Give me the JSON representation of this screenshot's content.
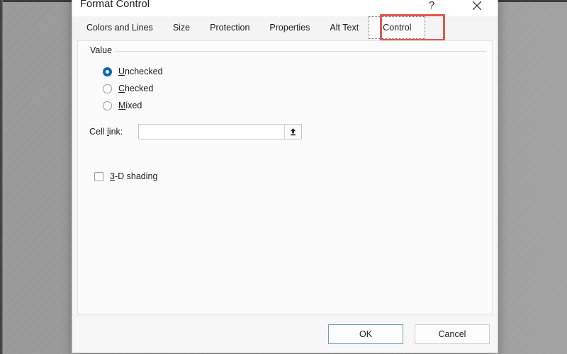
{
  "window": {
    "title": "Format Control",
    "help_icon": "question-mark-icon",
    "help_label": "?",
    "close_icon": "close-icon"
  },
  "tabs": [
    {
      "label": "Colors and Lines",
      "selected": false
    },
    {
      "label": "Size",
      "selected": false
    },
    {
      "label": "Protection",
      "selected": false
    },
    {
      "label": "Properties",
      "selected": false
    },
    {
      "label": "Alt Text",
      "selected": false
    },
    {
      "label": "Control",
      "selected": true
    }
  ],
  "highlight": {
    "target": "Control",
    "color": "#e4574e"
  },
  "control_tab": {
    "group": {
      "legend": "Value",
      "radios": [
        {
          "label": "Unchecked",
          "accelerator": "U",
          "pre": "",
          "post": "nchecked",
          "selected": true
        },
        {
          "label": "Checked",
          "accelerator": "C",
          "pre": "",
          "post": "hecked",
          "selected": false
        },
        {
          "label": "Mixed",
          "accelerator": "M",
          "pre": "",
          "post": "ixed",
          "selected": false
        }
      ],
      "cell_link": {
        "label_pre": "Cell ",
        "label_accelerator": "l",
        "label_post": "ink:",
        "value": "",
        "placeholder": "",
        "picker_icon": "collapse-dialog-arrow-icon"
      },
      "shading": {
        "label_pre": "",
        "label_accelerator": "3",
        "label_post": "-D shading",
        "checked": false
      }
    }
  },
  "footer": {
    "ok_label": "OK",
    "cancel_label": "Cancel"
  },
  "colors": {
    "accent_blue": "#0c68b4",
    "highlight_red": "#e4574e",
    "default_button_border": "#6ea2ba",
    "dialog_background": "#f7f7f7",
    "desktop_background": "#9a9a9a"
  }
}
